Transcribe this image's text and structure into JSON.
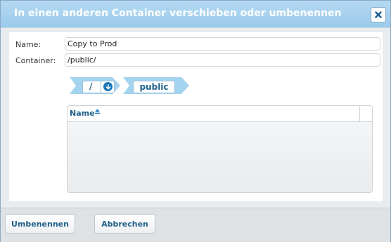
{
  "dialog": {
    "title": "In einen anderen Container verschieben oder umbenennen",
    "close_icon": "close-icon"
  },
  "form": {
    "name_label": "Name:",
    "name_value": "Copy to Prod",
    "container_label": "Container:",
    "container_value": "/public/"
  },
  "breadcrumb": {
    "items": [
      {
        "label": "/",
        "has_dropdown": true,
        "dropdown_icon": "chevron-down-circle-icon"
      },
      {
        "label": "public",
        "has_dropdown": false
      }
    ]
  },
  "grid": {
    "columns": [
      {
        "label": "Name",
        "sort_icon": "sort-ascending-icon"
      }
    ],
    "rows": []
  },
  "footer": {
    "rename_label": "Umbenennen",
    "cancel_label": "Abbrechen"
  },
  "colors": {
    "title_bar": "#9ccbeb",
    "breadcrumb": "#a4d3ef",
    "link_text": "#21618c",
    "dropdown_badge": "#1b76b8"
  }
}
